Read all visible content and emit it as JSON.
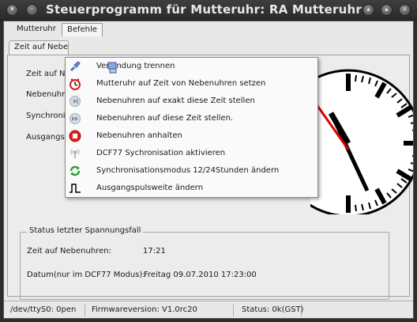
{
  "window": {
    "title": "Steuerprogramm für Mutteruhr: RA Mutteruhr",
    "menu": [
      "Mutteruhr",
      "Befehle"
    ]
  },
  "tab": {
    "label": "Zeit auf Nebenuhren"
  },
  "fields": {
    "row1": "Zeit auf Nebenuhren:",
    "row2": "Nebenuhren:",
    "row3": "Synchronisation:",
    "row4": "Ausgangspulsweite:"
  },
  "dropdown": {
    "items": [
      {
        "label": "Verbindung trennen",
        "icon": "disconnect-icon"
      },
      {
        "label": "Mutteruhr auf Zeit von Nebenuhren setzen",
        "icon": "clock-set-icon"
      },
      {
        "label": "Nebenuhren auf exakt diese Zeit stellen",
        "icon": "skip-forward-icon"
      },
      {
        "label": "Nebenuhren auf diese Zeit stellen.",
        "icon": "fast-forward-icon"
      },
      {
        "label": "Nebenuhren anhalten",
        "icon": "stop-icon"
      },
      {
        "label": "DCF77 Sychronisation aktivieren",
        "icon": "radio-antenna-icon"
      },
      {
        "label": "Synchronisationsmodus 12/24Stunden ändern",
        "icon": "refresh-icon"
      },
      {
        "label": "Ausgangspulsweite ändern",
        "icon": "pulse-icon"
      }
    ]
  },
  "status_group": {
    "title": "Status letzter Spannungsfall",
    "time_label": "Zeit auf Nebenuhren:",
    "time_value": "17:21",
    "date_label": "Datum(nur im DCF77 Modus):",
    "date_value": "Freitag  09.07.2010 17:23:00"
  },
  "statusbar": {
    "port": "/dev/ttyS0: 0pen",
    "firmware": "Firmwareversion: V1.0rc20",
    "status": "Status: 0k(GST)"
  },
  "colors": {
    "accent_red": "#e00000",
    "menu_highlight": "#f4f4f4"
  }
}
